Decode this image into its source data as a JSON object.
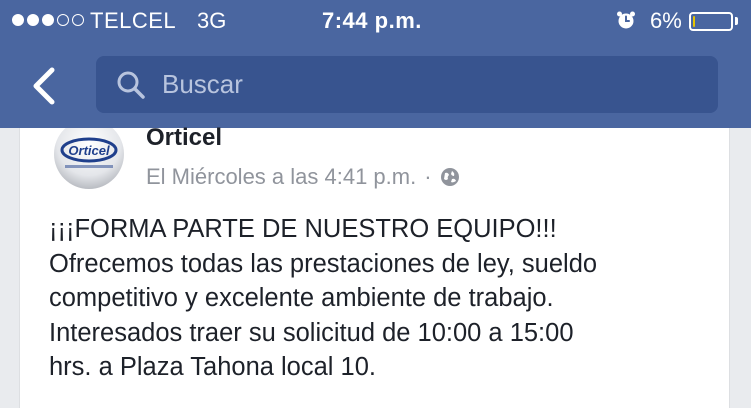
{
  "status_bar": {
    "carrier": "TELCEL",
    "network": "3G",
    "time": "7:44 p.m.",
    "battery_percent": "6%",
    "signal_bars_filled": 3,
    "signal_bars_total": 5,
    "battery_level": 0.06,
    "battery_color": "#e6c300"
  },
  "nav": {
    "back_icon": "chevron-left-icon",
    "search_placeholder": "Buscar",
    "search_icon": "search-icon"
  },
  "post": {
    "page_name": "Orticel",
    "avatar_text": "Orticel",
    "timestamp": "El Miércoles a las 4:41 p.m.",
    "separator": "·",
    "privacy_icon": "globe-icon",
    "text_lines": [
      "¡¡¡FORMA PARTE DE NUESTRO EQUIPO!!!",
      "Ofrecemos todas las prestaciones de ley, sueldo",
      "competitivo y excelente ambiente de trabajo.",
      "Interesados traer su solicitud de 10:00 a 15:00",
      "hrs. a Plaza Tahona local 10."
    ]
  },
  "colors": {
    "header_bg": "#4a66a0",
    "search_bg": "#38548f",
    "text_primary": "#1d2129",
    "text_secondary": "#90949c"
  }
}
